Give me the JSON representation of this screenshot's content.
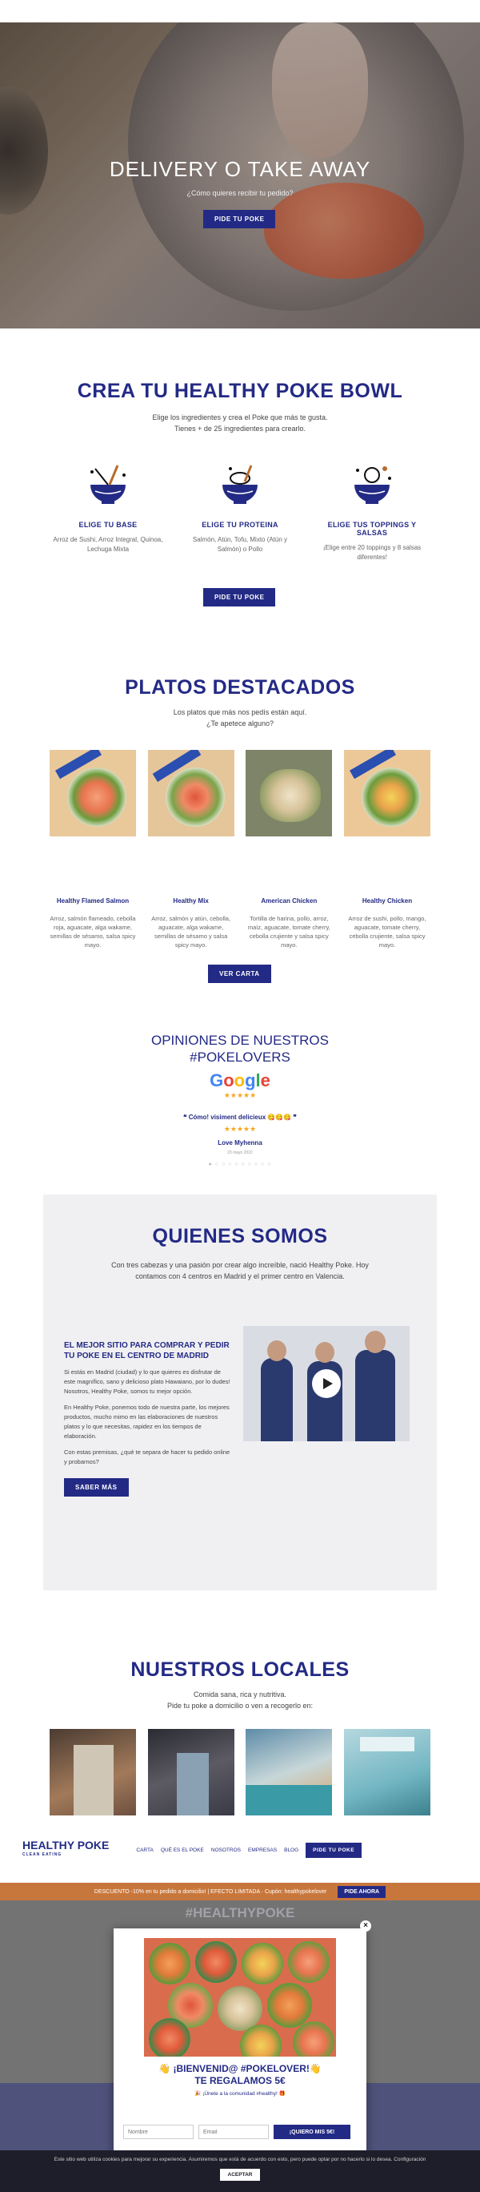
{
  "hero": {
    "title": "DELIVERY O TAKE AWAY",
    "subtitle": "¿Cómo quieres recibir tu pedido?",
    "button": "PIDE TU POKE"
  },
  "crea": {
    "title": "CREA TU HEALTHY POKE BOWL",
    "line1": "Elige los ingredientes y crea el Poke que más te gusta.",
    "line2": "Tienes + de 25 ingredientes para crearlo.",
    "steps": [
      {
        "title": "ELIGE TU BASE",
        "text": "Arroz de Sushi, Arroz Integral, Quinoa, Lechuga Mixta"
      },
      {
        "title": "ELIGE TU PROTEINA",
        "text": "Salmón, Atún, Tofu, Mixto (Atún y Salmón) o Pollo"
      },
      {
        "title": "ELIGE TUS TOPPINGS Y SALSAS",
        "text": "¡Elige entre 20 toppings y 8 salsas diferentes!"
      }
    ],
    "button": "PIDE TU POKE"
  },
  "platos": {
    "title": "PLATOS DESTACADOS",
    "line1": "Los platos que más nos pedís están aquí.",
    "line2": "¿Te apetece alguno?",
    "dishes": [
      {
        "name": "Healthy Flamed Salmon",
        "desc": "Arroz, salmón flameado, cebolla roja, aguacate, alga wakame, semillas de sésamo, salsa spicy mayo."
      },
      {
        "name": "Healthy Mix",
        "desc": "Arroz, salmón y atún, cebolla, aguacate, alga wakame, semillas de sésamo y salsa spicy mayo."
      },
      {
        "name": "American Chicken",
        "desc": "Tortilla de harina, pollo, arroz, maíz, aguacate, tomate cherry, cebolla crujiente y salsa spicy mayo."
      },
      {
        "name": "Healthy Chicken",
        "desc": "Arroz de sushi, pollo, mango, aguacate, tomate cherry, cebolla crujiente, salsa spicy mayo."
      }
    ],
    "button": "VER CARTA"
  },
  "opiniones": {
    "title_line1": "OPINIONES DE NUESTROS",
    "title_line2": "#POKELOVERS",
    "google": [
      "G",
      "o",
      "o",
      "g",
      "l",
      "e"
    ],
    "stars": "★★★★★",
    "quote": "❝ Cómo! visiment delicieux 😋😋😋 ❞",
    "review_stars": "★★★★★",
    "author": "Love Myhenna",
    "date": "23 mayo 2022",
    "dots": "● ○ ○ ○ ○ ○ ○ ○ ○ ○"
  },
  "quienes": {
    "title": "QUIENES SOMOS",
    "intro": "Con tres cabezas y una pasión por crear algo increíble, nació Healthy Poke. Hoy contamos con 4 centros en Madrid y el primer centro en Valencia.",
    "heading": "EL MEJOR SITIO PARA COMPRAR Y PEDIR TU POKE EN EL CENTRO DE MADRID",
    "p1": "Si estás en Madrid (ciudad) y lo que quieres es disfrutar de este magnífico, sano y delicioso plato Hawaiano, por lo dudes! Nosotros, Healthy Poke, somos tu mejor opción.",
    "p2": "En Healthy Poke, ponemos todo de nuestra parte, los mejores productos, mucho mimo en las elaboraciones de nuestros platos y lo que necesitas, rapidez en los tiempos de elaboración.",
    "p3": "Con estas premisas, ¿qué te separa de hacer tu pedido online y probarnos?",
    "button": "SABER MÁS"
  },
  "locales": {
    "title": "NUESTROS LOCALES",
    "line1": "Comida sana, rica y nutritiva.",
    "line2": "Pide tu poke a domicilio o ven a recogerlo en:"
  },
  "header": {
    "logo": "HEALTHY POKE",
    "logo_sub": "CLEAN EATING",
    "nav": [
      "CARTA",
      "QUÉ ES EL POKE",
      "NOSOTROS",
      "EMPRESAS",
      "BLOG"
    ],
    "cta": "PIDE TU POKE"
  },
  "promo": {
    "text": "DESCUENTO -10% en tu pedido a domicilio! | EFECTO LIMITADA · Cupón: healthypokelover",
    "button": "PIDE AHORA"
  },
  "hashtag": "#HEALTHYPOKE",
  "modal": {
    "title_line1": "👋 ¡BIENVENID@ #POKELOVER!👋",
    "title_line2": "TE REGALAMOS 5€",
    "small": "🎉 ¡Únete a la comunidad #healthy! 🎁",
    "name_placeholder": "Nombre",
    "email_placeholder": "Email",
    "button": "¡QUIERO MIS 5€!",
    "close": "×"
  },
  "cookie": {
    "text": "Este sitio web utiliza cookies para mejorar su experiencia. Asumiremos que está de acuerdo con esto, pero puede optar por no hacerlo si lo desea. Configuración",
    "button": "ACEPTAR"
  }
}
